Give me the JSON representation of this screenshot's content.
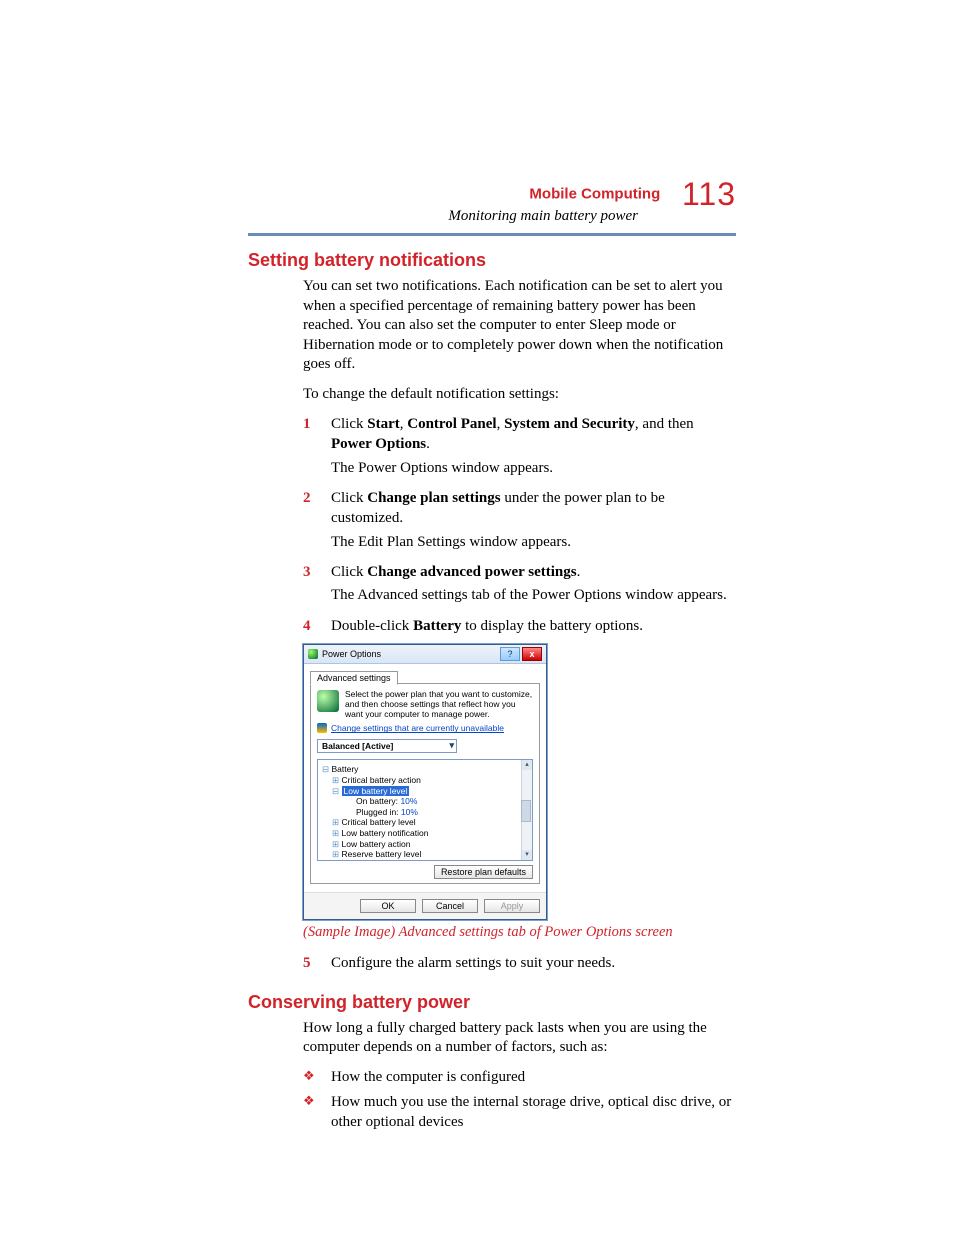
{
  "header": {
    "chapter_title": "Mobile Computing",
    "section_subtitle": "Monitoring main battery power",
    "page_number": "113"
  },
  "section1": {
    "heading": "Setting battery notifications",
    "intro": "You can set two notifications. Each notification can be set to alert you when a specified percentage of remaining battery power has been reached. You can also set the computer to enter Sleep mode or Hibernation mode or to completely power down when the notification goes off.",
    "lead_in": "To change the default notification settings:",
    "steps": [
      {
        "num": "1",
        "pre": "Click ",
        "b1": "Start",
        "m1": ", ",
        "b2": "Control Panel",
        "m2": ", ",
        "b3": "System and Security",
        "m3": ", and then ",
        "b4": "Power Options",
        "post": ".",
        "after": "The Power Options window appears."
      },
      {
        "num": "2",
        "pre": "Click ",
        "b1": "Change plan settings",
        "post": " under the power plan to be customized.",
        "after": "The Edit Plan Settings window appears."
      },
      {
        "num": "3",
        "pre": "Click ",
        "b1": "Change advanced power settings",
        "post": ".",
        "after": "The Advanced settings tab of the Power Options window appears."
      },
      {
        "num": "4",
        "pre": "Double-click ",
        "b1": "Battery",
        "post": " to display the battery options."
      }
    ],
    "caption": "(Sample Image) Advanced settings tab of Power Options screen",
    "step5": {
      "num": "5",
      "text": "Configure the alarm settings to suit your needs."
    }
  },
  "dialog": {
    "title": "Power Options",
    "help_glyph": "?",
    "close_glyph": "x",
    "tab_label": "Advanced settings",
    "description": "Select the power plan that you want to customize, and then choose settings that reflect how you want your computer to manage power.",
    "link_unavailable": "Change settings that are currently unavailable",
    "plan_selected": "Balanced [Active]",
    "tree": {
      "root": "Battery",
      "items": [
        {
          "indent": 1,
          "exp": "⊞",
          "label": "Critical battery action"
        },
        {
          "indent": 1,
          "exp": "⊟",
          "label_sel": "Low battery level"
        },
        {
          "indent": 3,
          "label": "On battery:",
          "value": "10%"
        },
        {
          "indent": 3,
          "label": "Plugged in:",
          "value": "10%"
        },
        {
          "indent": 1,
          "exp": "⊞",
          "label": "Critical battery level"
        },
        {
          "indent": 1,
          "exp": "⊞",
          "label": "Low battery notification"
        },
        {
          "indent": 1,
          "exp": "⊞",
          "label": "Low battery action"
        },
        {
          "indent": 1,
          "exp": "⊞",
          "label": "Reserve battery level"
        }
      ]
    },
    "restore_label": "Restore plan defaults",
    "ok_label": "OK",
    "cancel_label": "Cancel",
    "apply_label": "Apply"
  },
  "section2": {
    "heading": "Conserving battery power",
    "intro": "How long a fully charged battery pack lasts when you are using the computer depends on a number of factors, such as:",
    "bullets": [
      "How the computer is configured",
      "How much you use the internal storage drive, optical disc drive, or other optional devices"
    ]
  }
}
